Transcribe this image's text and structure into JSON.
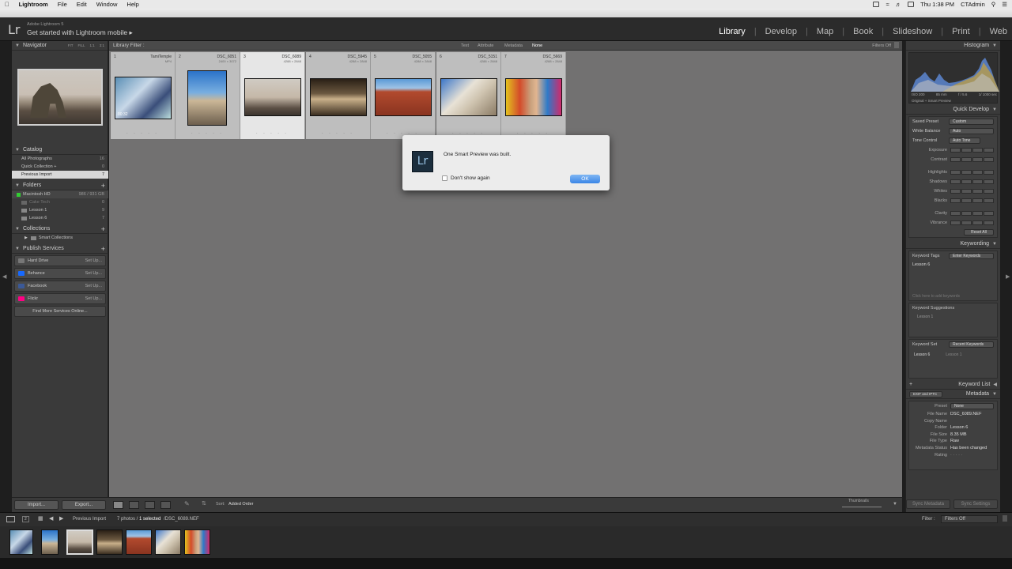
{
  "menubar": {
    "app": "Lightroom",
    "items": [
      "File",
      "Edit",
      "Window",
      "Help"
    ],
    "right_time": "Thu 1:38 PM",
    "right_user": "CTAdmin"
  },
  "topbar": {
    "logo": "Lr",
    "identity_sub": "Adobe Lightroom 5",
    "identity_main": "Get started with Lightroom mobile",
    "modules": [
      "Library",
      "Develop",
      "Map",
      "Book",
      "Slideshow",
      "Print",
      "Web"
    ]
  },
  "left_panel": {
    "navigator_title": "Navigator",
    "navigator_zoom": [
      "FIT",
      "FILL",
      "1:1",
      "3:1"
    ],
    "catalog_title": "Catalog",
    "catalog_items": [
      {
        "label": "All Photographs",
        "count": "16"
      },
      {
        "label": "Quick Collection +",
        "count": "0"
      },
      {
        "label": "Previous Import",
        "count": "7"
      }
    ],
    "folders_title": "Folders",
    "volume": {
      "label": "Macintosh HD",
      "count": "986 / 931 GB"
    },
    "folders": [
      {
        "label": "Cake Tech",
        "count": "0"
      },
      {
        "label": "Lesson 1",
        "count": "9"
      },
      {
        "label": "Lesson 6",
        "count": "7"
      }
    ],
    "collections_title": "Collections",
    "collections": [
      {
        "label": "Smart Collections"
      }
    ],
    "publish_title": "Publish Services",
    "publish": [
      {
        "label": "Hard Drive",
        "action": "Set Up...",
        "color": "#777777"
      },
      {
        "label": "Behance",
        "action": "Set Up...",
        "color": "#1769ff"
      },
      {
        "label": "Facebook",
        "action": "Set Up...",
        "color": "#3b5998"
      },
      {
        "label": "Flickr",
        "action": "Set Up...",
        "color": "#ff0084"
      }
    ],
    "find_more": "Find More Services Online..."
  },
  "center": {
    "filter_title": "Library Filter :",
    "filter_tabs": [
      "Text",
      "Attribute",
      "Metadata",
      "None"
    ],
    "filters_off": "Filters Off",
    "cells": [
      {
        "num": "1",
        "name": "TamiTemple",
        "dim": "MP4"
      },
      {
        "num": "2",
        "name": "DSC_6051",
        "dim": "2400 × 3072"
      },
      {
        "num": "3",
        "name": "DSC_6089",
        "dim": "4288 × 2848"
      },
      {
        "num": "4",
        "name": "DSC_5945",
        "dim": "4288 × 2848"
      },
      {
        "num": "5",
        "name": "DSC_5055",
        "dim": "4288 × 2848"
      },
      {
        "num": "6",
        "name": "DSC_5151",
        "dim": "4288 × 2848"
      },
      {
        "num": "7",
        "name": "DSC_5669",
        "dim": "4288 × 2848"
      }
    ],
    "video_time": "00:32"
  },
  "dialog": {
    "icon": "Lr",
    "message": "One Smart Preview was built.",
    "checkbox_label": "Don't show again",
    "ok_label": "OK"
  },
  "right_panel": {
    "histogram_title": "Histogram",
    "histo_info": [
      "ISO 200",
      "85 mm",
      "f / 5.6",
      "1/ 1000 sec"
    ],
    "histo_status": "Original + Smart Preview",
    "quick_develop_title": "Quick Develop",
    "saved_preset_label": "Saved Preset",
    "saved_preset_value": "Custom",
    "white_balance_label": "White Balance",
    "white_balance_value": "Auto",
    "tone_control_label": "Tone Control",
    "auto_tone": "Auto Tone",
    "tone_rows": [
      "Exposure",
      "Contrast",
      "Highlights",
      "Shadows",
      "Whites",
      "Blacks",
      "Clarity",
      "Vibrance"
    ],
    "reset_all": "Reset All",
    "keywording_title": "Keywording",
    "keyword_tags_label": "Keyword Tags",
    "keyword_tags_value": "Enter Keywords",
    "keyword_current": "Lesson 6",
    "keyword_placeholder": "Click here to add keywords",
    "keyword_suggestions_label": "Keyword Suggestions",
    "keyword_suggestion": "Lesson 1",
    "keyword_set_label": "Keyword Set",
    "keyword_set_value": "Recent Keywords",
    "keyword_set_items": [
      "Lesson 6",
      "Lesson 1"
    ],
    "keyword_list_title": "Keyword List",
    "metadata_title": "Metadata",
    "metadata_mode": "EXIF and IPTC",
    "preset_label": "Preset",
    "preset_value": "None",
    "meta_rows": [
      {
        "label": "File Name",
        "value": "DSC_6089.NEF"
      },
      {
        "label": "Copy Name",
        "value": ""
      },
      {
        "label": "Folder",
        "value": "Lesson 6"
      },
      {
        "label": "File Size",
        "value": "8.35 MB"
      },
      {
        "label": "File Type",
        "value": "Raw"
      },
      {
        "label": "Metadata Status",
        "value": "Has been changed"
      },
      {
        "label": "Rating",
        "value": "· · · · ·"
      }
    ]
  },
  "toolbar": {
    "import": "Import...",
    "export": "Export...",
    "sort_label": "Sort:",
    "sort_value": "Added Order",
    "thumbnails_label": "Thumbnails",
    "sync_metadata": "Sync Metadata",
    "sync_settings": "Sync Settings"
  },
  "filmbar": {
    "pages": [
      "1",
      "2"
    ],
    "source": "Previous Import",
    "count_text": "7 photos /",
    "selected_text": "1 selected",
    "file_text": "/DSC_6089.NEF",
    "filter_label": "Filter :",
    "filter_value": "Filters Off"
  }
}
